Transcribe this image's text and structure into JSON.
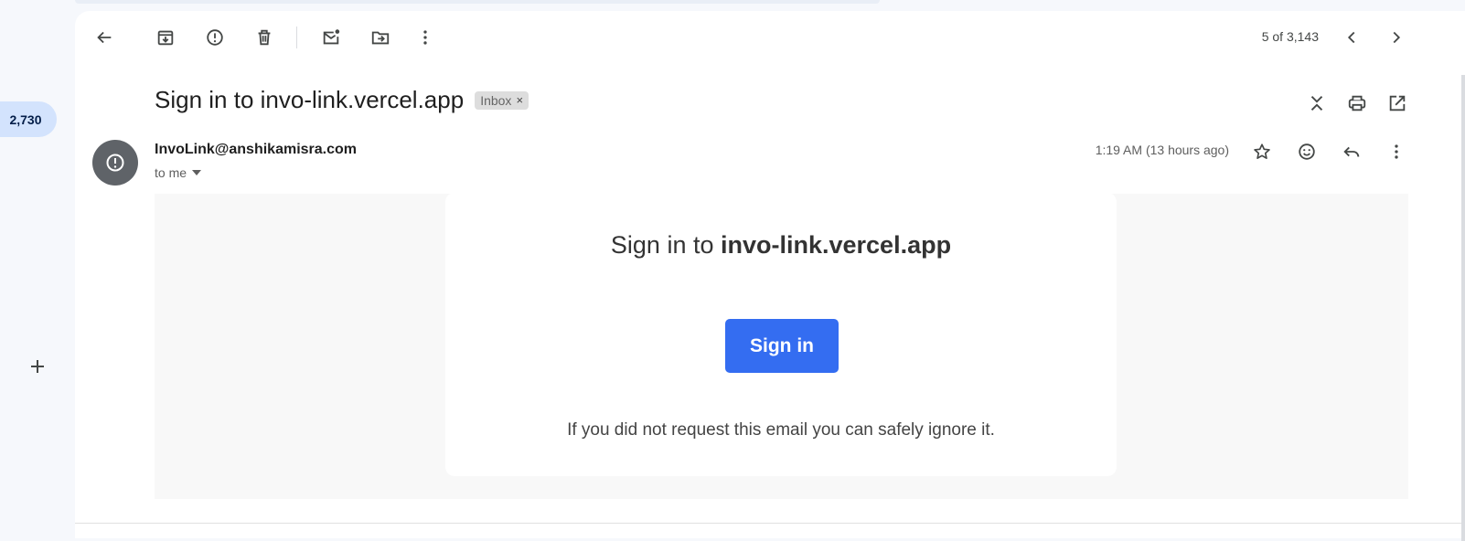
{
  "rail": {
    "unread_count": "2,730",
    "add_icon": "plus-icon"
  },
  "toolbar": {
    "back_icon": "arrow-left-icon",
    "archive_icon": "archive-icon",
    "spam_icon": "report-spam-icon",
    "delete_icon": "trash-icon",
    "unread_icon": "mark-unread-icon",
    "move_icon": "move-to-folder-icon",
    "more_icon": "more-vert-icon",
    "pager_text": "5 of 3,143",
    "prev_icon": "chevron-left-icon",
    "next_icon": "chevron-right-icon"
  },
  "message": {
    "subject": "Sign in to invo-link.vercel.app",
    "label": "Inbox",
    "label_remove": "×",
    "sender": "InvoLink@anshikamisra.com",
    "recipient": "to me",
    "time": "1:19 AM (13 hours ago)"
  },
  "body": {
    "title_prefix": "Sign in to ",
    "title_domain": "invo-link.vercel.app",
    "button_label": "Sign in",
    "ignore_text": "If you did not request this email you can safely ignore it."
  },
  "colors": {
    "button": "#346df1",
    "pill": "#d3e3fd",
    "avatar": "#5f6368"
  }
}
